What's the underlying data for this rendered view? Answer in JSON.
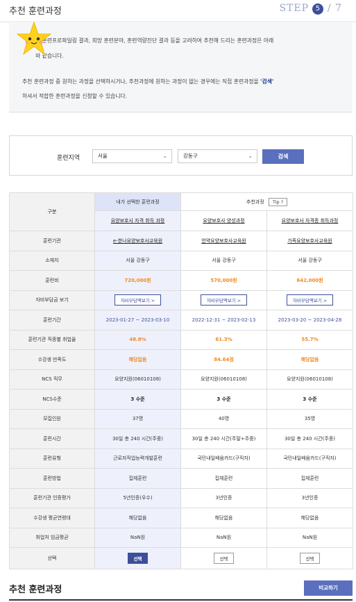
{
  "header": {
    "title": "추천 훈련과정",
    "step_label": "STEP",
    "step_num": "5",
    "step_total": "/ 7"
  },
  "info": {
    "line1": "의 훈련프로파일링 결과, 희망 훈련분야, 훈련역량진단 결과 등을 고려하여 추천해 드리는 훈련과정은 아래",
    "line2": "와 같습니다.",
    "line3_pre": "추천 훈련과정 중 원하는 과정을 선택하시거나, 추천과정에 원하는 과정이 없는 경우에는 직접 훈련과정을 ",
    "line3_bold": "'검색'",
    "line4": "하셔서 적합한 훈련과정을 신청할 수 있습니다."
  },
  "search": {
    "label": "훈련지역",
    "region": "서울",
    "district": "강동구",
    "button": "검색"
  },
  "table": {
    "gubun": "구분",
    "selected_header": "내가 선택한 훈련과정",
    "recommend_header": "추천과정",
    "tip": "Tip ?",
    "courses": [
      "요양보호사 자격 취득 과정",
      "요양보호사 양성과정",
      "요양보호사 자격증 취득과정"
    ],
    "rows": [
      {
        "label": "훈련기관",
        "values": [
          "e-한나요양보호사교육원",
          "언약요양보호사교육원",
          "가족요양보호사교육원"
        ]
      },
      {
        "label": "소재지",
        "values": [
          "서울 강동구",
          "서울 강동구",
          "서울 강동구"
        ]
      },
      {
        "label": "훈련비",
        "values": [
          "720,000원",
          "570,000원",
          "642,000원"
        ]
      },
      {
        "label": "자비부담금 보기",
        "values": [
          "자비부담액보기 >",
          "자비부담액보기 >",
          "자비부담액보기 >"
        ]
      },
      {
        "label": "훈련기간",
        "values": [
          "2023-01-27 ~ 2023-03-10",
          "2022-12-31 ~ 2023-02-13",
          "2023-03-20 ~ 2023-04-28"
        ]
      },
      {
        "label": "훈련기관 직종별 취업율",
        "values": [
          "48.8%",
          "61.3%",
          "55.7%"
        ]
      },
      {
        "label": "수강생 만족도",
        "values": [
          "해당없음",
          "84.64점",
          "해당없음"
        ]
      },
      {
        "label": "NCS 직무",
        "values": [
          "요양지원(06010108)",
          "요양지원(06010108)",
          "요양지원(06010108)"
        ]
      },
      {
        "label": "NCS수준",
        "values": [
          "3 수준",
          "3 수준",
          "3 수준"
        ]
      },
      {
        "label": "모집인원",
        "values": [
          "37명",
          "40명",
          "35명"
        ]
      },
      {
        "label": "훈련시간",
        "values": [
          "30일 총 240 시간(주중)",
          "30일 총 240 시간(주말+주중)",
          "30일 총 240 시간(주중)"
        ]
      },
      {
        "label": "훈련유형",
        "values": [
          "근로자직업능력개발훈련",
          "국민내일배움카드(구직자)",
          "국민내일배움카드(구직자)"
        ]
      },
      {
        "label": "훈련방법",
        "values": [
          "집체훈련",
          "집체훈련",
          "집체훈련"
        ]
      },
      {
        "label": "훈련기관 인증평가",
        "values": [
          "5년인증(우수)",
          "3년인증",
          "3년인증"
        ]
      },
      {
        "label": "수강생 평균연령대",
        "values": [
          "해당없음",
          "해당없음",
          "해당없음"
        ]
      },
      {
        "label": "취업처 임금평균",
        "values": [
          "NaN원",
          "NaN원",
          "NaN원"
        ]
      }
    ],
    "select_label": "선택",
    "select_buttons": [
      "선택",
      "선택",
      "선택"
    ]
  },
  "footer": {
    "title": "추천 훈련과정",
    "compare_button": "비교하기"
  },
  "colors": {
    "accent": "#3d4f9b",
    "button": "#5b6fbf",
    "orange": "#f08a24"
  }
}
